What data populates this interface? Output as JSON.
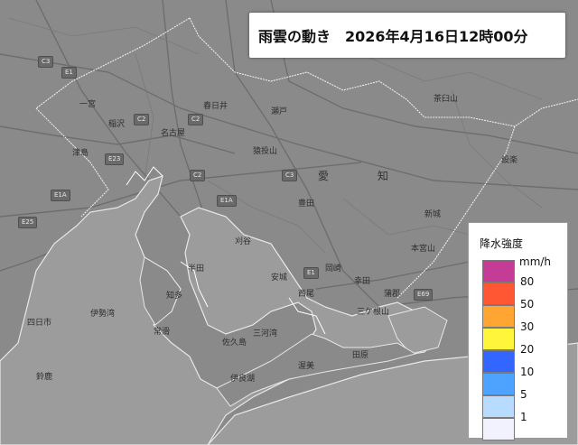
{
  "title": {
    "label": "雨雲の動き",
    "datetime": "2026年4月16日12時00分"
  },
  "map": {
    "prefecture": [
      "愛",
      "知"
    ],
    "place_labels": [
      "名古屋",
      "春日井",
      "豊橋",
      "瀬戸",
      "豊田",
      "岡崎",
      "刈谷",
      "安城",
      "知多",
      "半田",
      "常滑",
      "蒲郡",
      "西尾",
      "幸田",
      "新城",
      "設楽",
      "一宮",
      "稲沢",
      "津島",
      "四日市",
      "鈴鹿",
      "伊勢湾",
      "三河湾",
      "佐久島",
      "伊良湖",
      "渥美",
      "田原",
      "本宮山",
      "猿投山",
      "三ケ根山",
      "茶臼山"
    ],
    "road_labels": [
      "E1",
      "E1A",
      "E1A",
      "C3",
      "C2",
      "C2",
      "C2",
      "E23",
      "E25",
      "E69",
      "C3",
      "E1"
    ]
  },
  "legend": {
    "title": "降水強度",
    "unit": "mm/h",
    "items": [
      {
        "label": "80",
        "color": "#c43c96"
      },
      {
        "label": "50",
        "color": "#ff5733"
      },
      {
        "label": "30",
        "color": "#ffa531"
      },
      {
        "label": "20",
        "color": "#fff53b"
      },
      {
        "label": "10",
        "color": "#3366ff"
      },
      {
        "label": "5",
        "color": "#4da3ff"
      },
      {
        "label": "1",
        "color": "#b8dcff"
      },
      {
        "label": "",
        "color": "#f2f2ff"
      }
    ]
  },
  "colors": {
    "land": "#8a8a8a",
    "water": "#9c9c9c",
    "boundary": "#e8e8e8",
    "road": "#6a6a6a"
  }
}
